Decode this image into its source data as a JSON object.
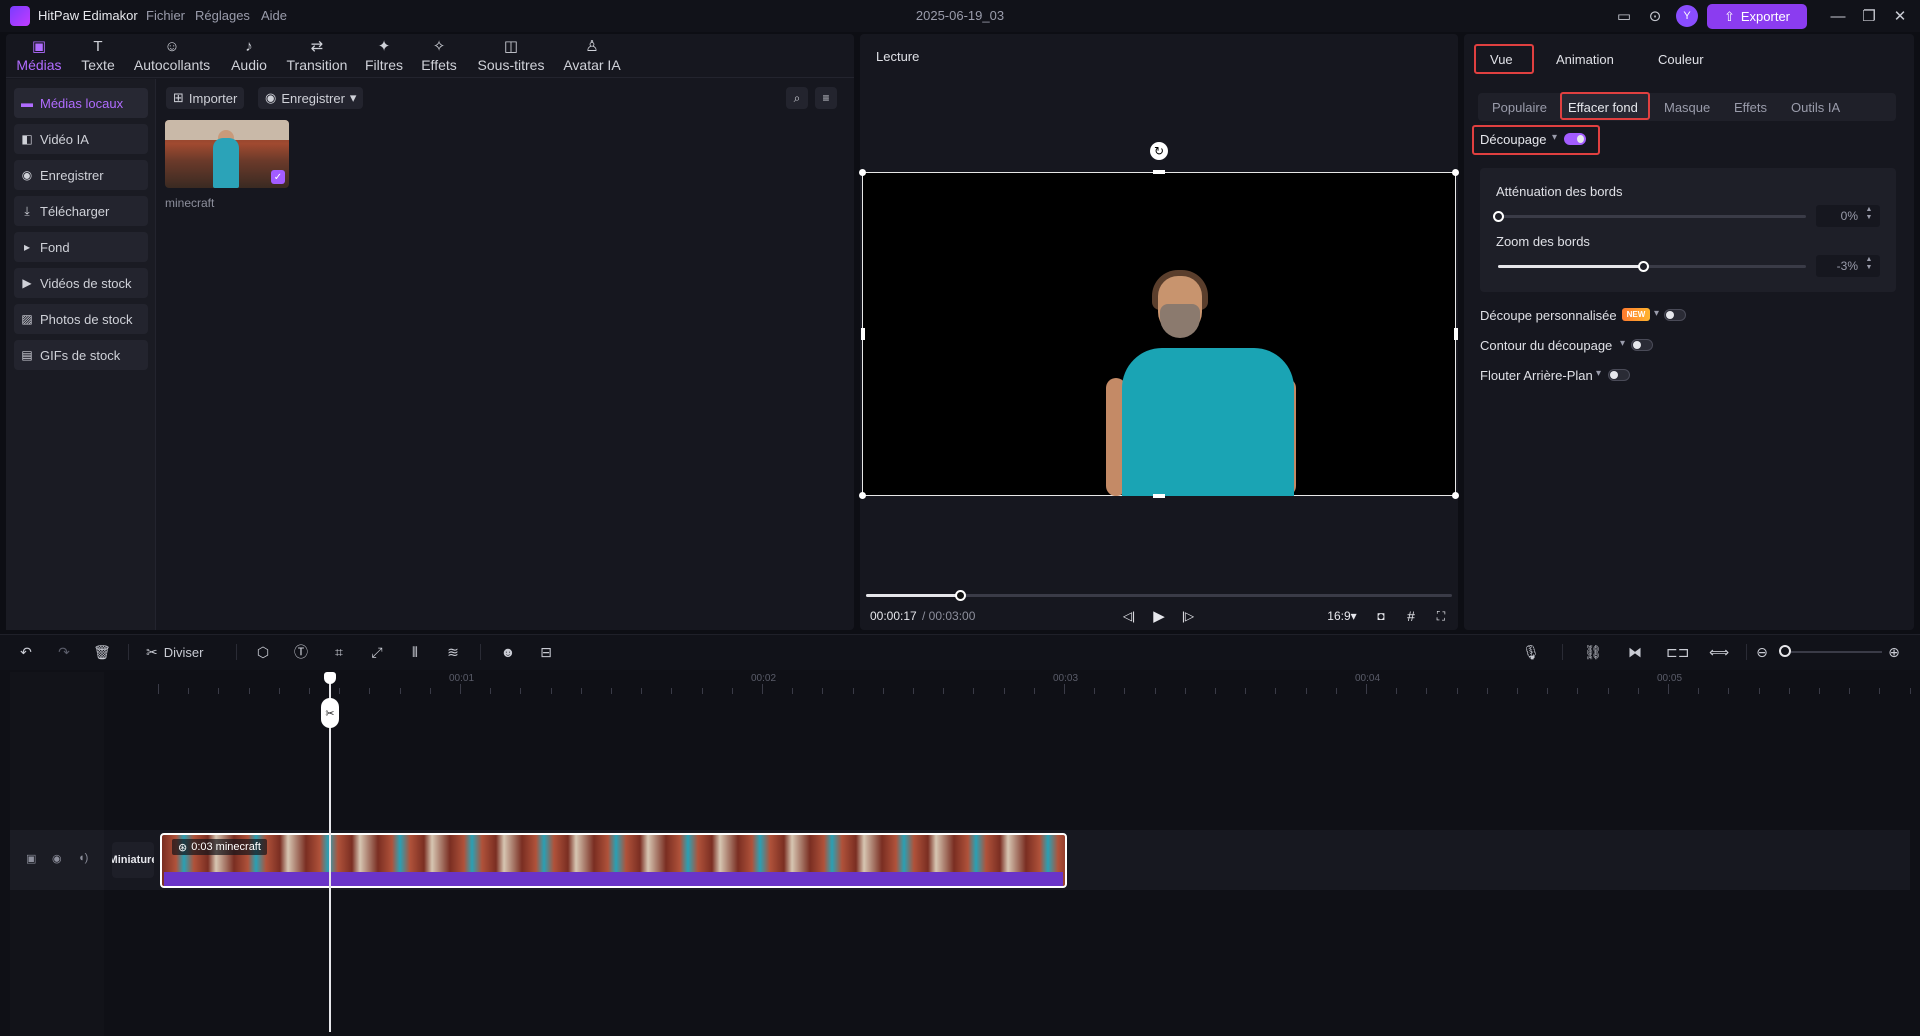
{
  "app": {
    "name": "HitPaw Edimakor",
    "project_title": "2025-06-19_03",
    "avatar_initial": "Y",
    "export_label": "Exporter"
  },
  "menu": [
    "Fichier",
    "Réglages",
    "Aide"
  ],
  "tool_tabs": [
    {
      "label": "Médias",
      "icon": "media-icon"
    },
    {
      "label": "Texte",
      "icon": "text-icon"
    },
    {
      "label": "Autocollants",
      "icon": "stickers-icon"
    },
    {
      "label": "Audio",
      "icon": "music-icon"
    },
    {
      "label": "Transition",
      "icon": "transition-icon"
    },
    {
      "label": "Filtres",
      "icon": "filter-icon"
    },
    {
      "label": "Effets",
      "icon": "effects-icon"
    },
    {
      "label": "Sous-titres",
      "icon": "subtitles-icon"
    },
    {
      "label": "Avatar IA",
      "icon": "avatar-icon"
    }
  ],
  "sidebar": [
    {
      "label": "Médias locaux",
      "icon": "folder-icon"
    },
    {
      "label": "Vidéo IA",
      "icon": "ai-video-icon"
    },
    {
      "label": "Enregistrer",
      "icon": "record-icon"
    },
    {
      "label": "Télécharger",
      "icon": "download-icon"
    },
    {
      "label": "Fond",
      "icon": "caret-right-icon"
    },
    {
      "label": "Vidéos de stock",
      "icon": "stock-video-icon"
    },
    {
      "label": "Photos de stock",
      "icon": "stock-photo-icon"
    },
    {
      "label": "GIFs de stock",
      "icon": "gif-icon"
    }
  ],
  "media": {
    "import_label": "Importer",
    "record_label": "Enregistrer",
    "item_name": "minecraft"
  },
  "preview": {
    "title": "Lecture",
    "time_current": "00:00:17",
    "time_total": "/ 00:03:00",
    "ratio": "16:9",
    "progress_fraction": 0.16
  },
  "right": {
    "tabs": [
      "Vue",
      "Animation",
      "Couleur"
    ],
    "subtabs": [
      "Populaire",
      "Effacer fond",
      "Masque",
      "Effets",
      "Outils IA"
    ],
    "cutout_label": "Découpage",
    "feather_label": "Atténuation des bords",
    "feather_value": "0%",
    "feather_fraction": 0.0,
    "edge_zoom_label": "Zoom des bords",
    "edge_zoom_value": "-3%",
    "edge_zoom_fraction": 0.47,
    "options": [
      {
        "label": "Découpe personnalisée",
        "badge": "NEW"
      },
      {
        "label": "Contour du découpage"
      },
      {
        "label": "Flouter Arrière-Plan"
      }
    ]
  },
  "timeline": {
    "split_label": "Diviser",
    "ruler_labels": [
      "00:01",
      "00:02",
      "00:03",
      "00:04",
      "00:05"
    ],
    "track_name": "Miniature",
    "clip_label": "0:03 minecraft"
  }
}
